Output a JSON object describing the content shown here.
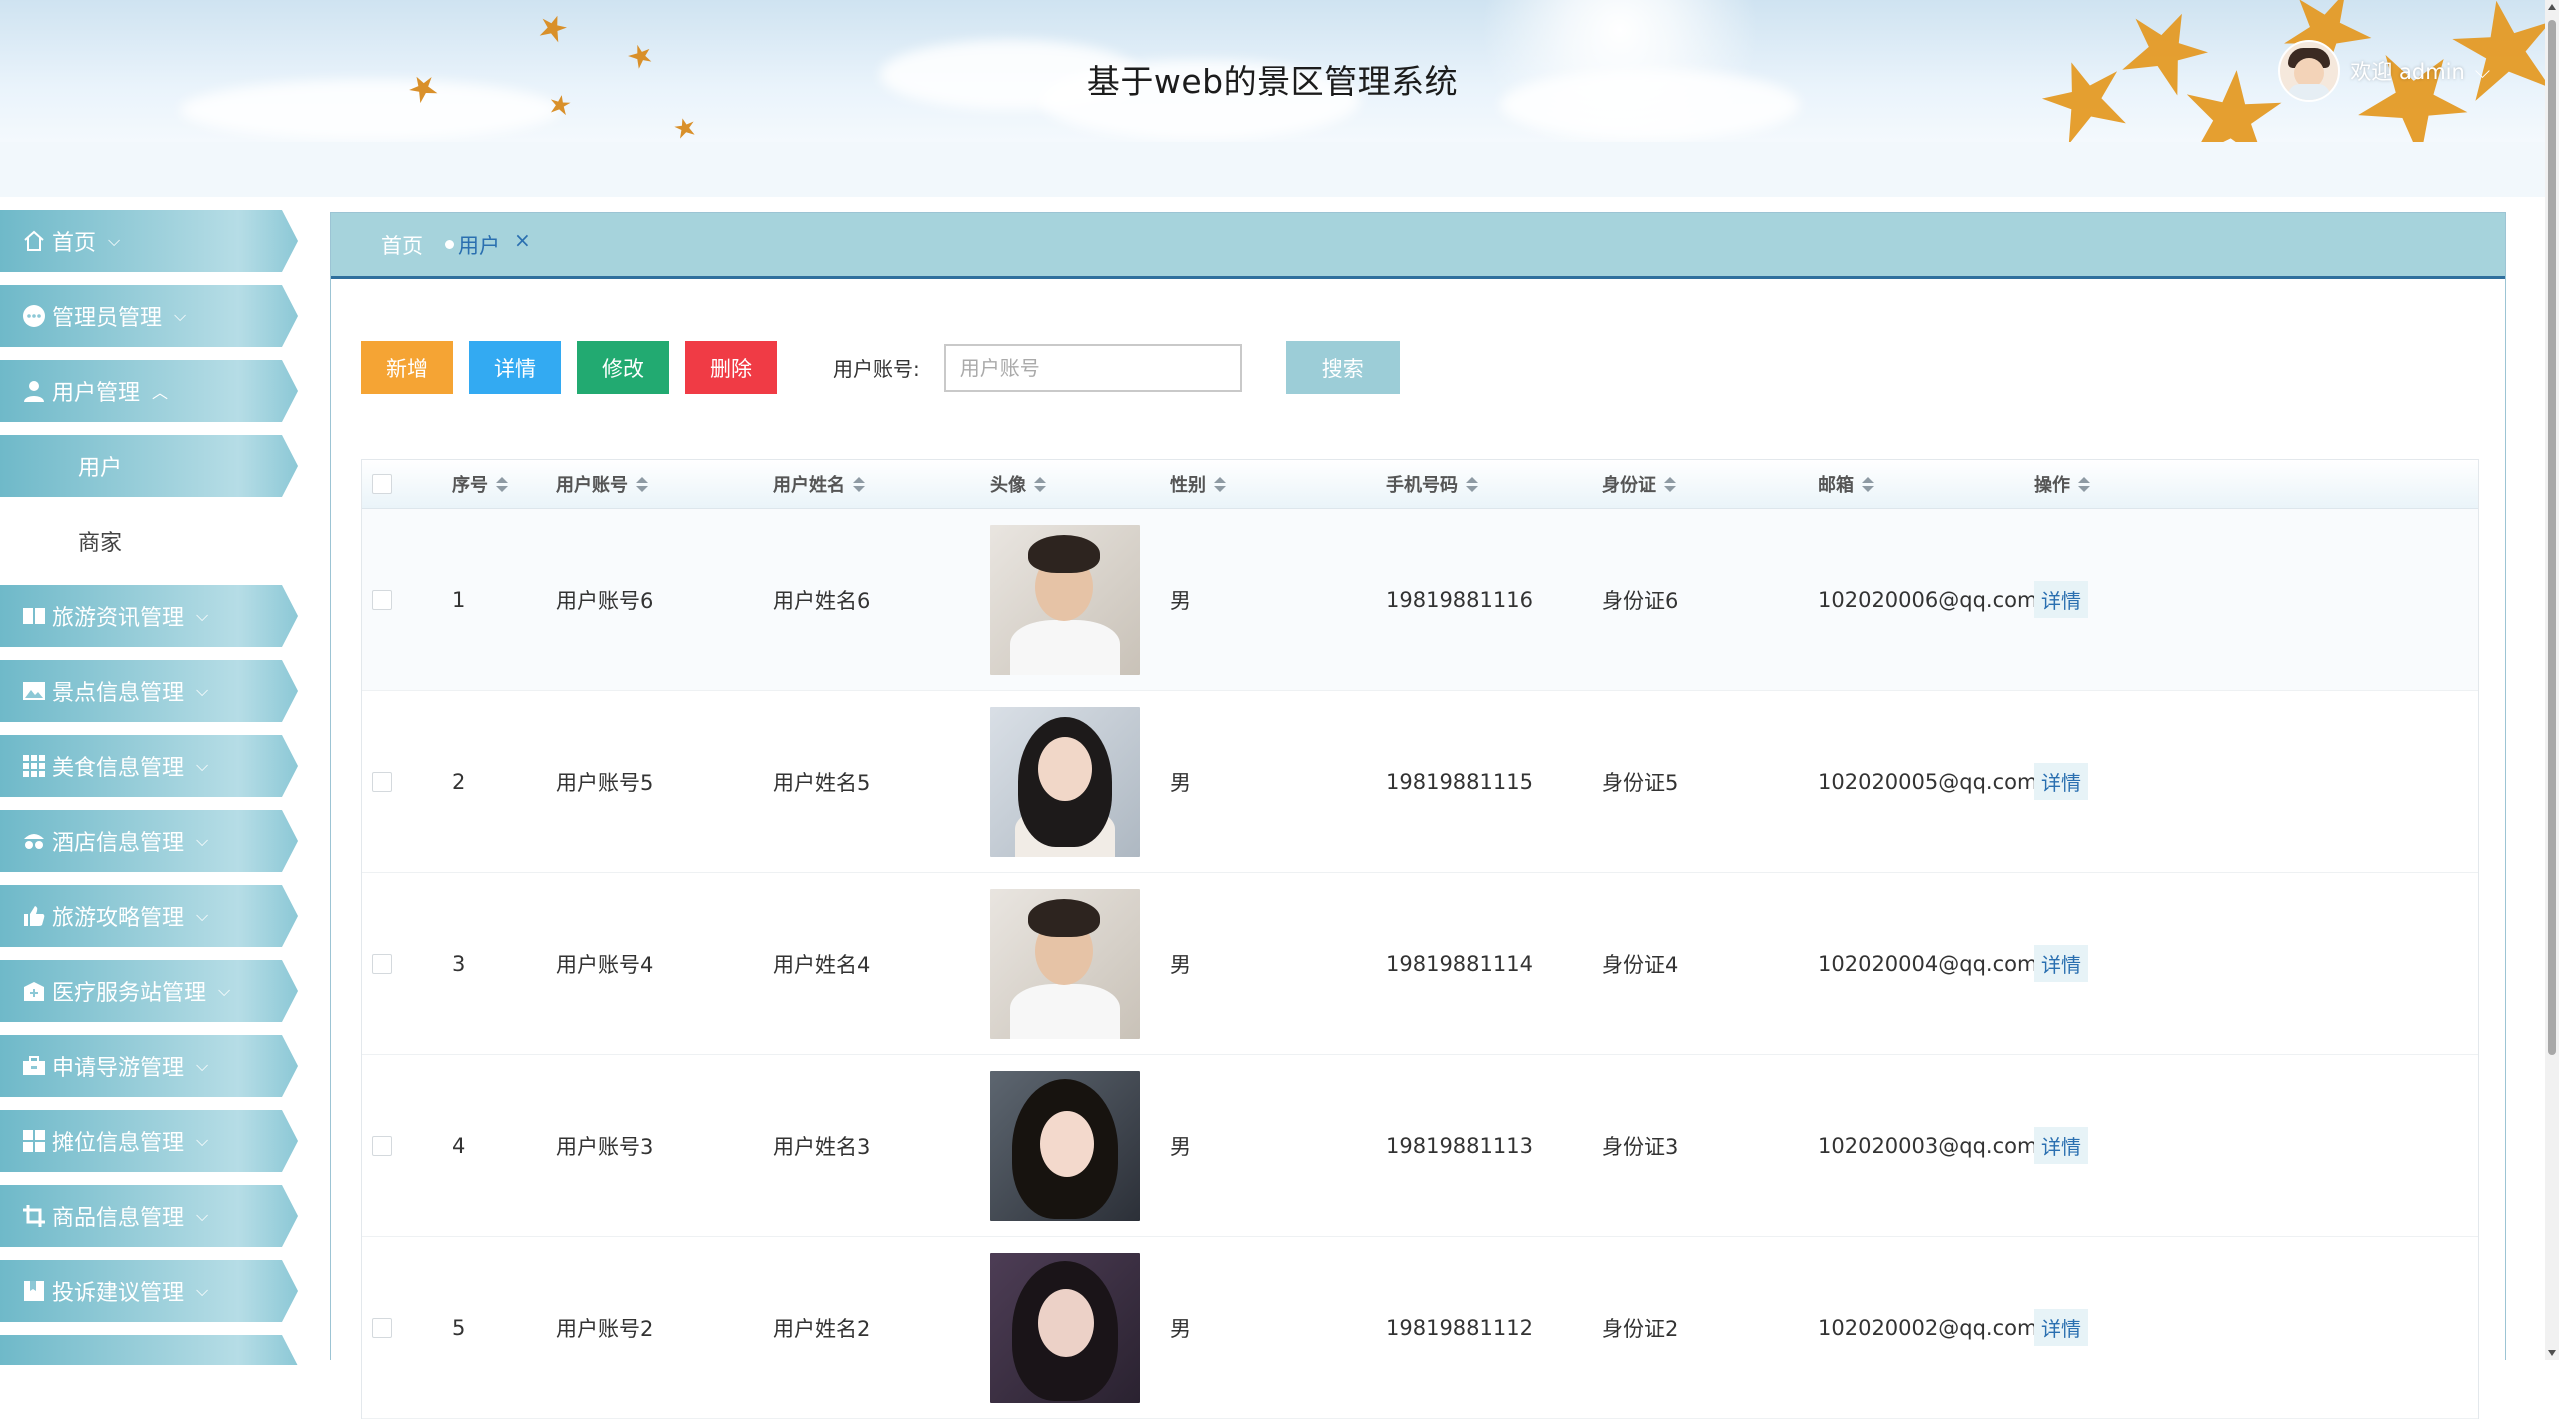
{
  "header": {
    "title": "基于web的景区管理系统",
    "welcome": "欢迎 admin"
  },
  "sidebar": {
    "items": [
      {
        "label": "首页",
        "icon": "home-icon"
      },
      {
        "label": "管理员管理",
        "icon": "more-circle-icon"
      },
      {
        "label": "用户管理",
        "icon": "user-icon",
        "expanded": true,
        "children": [
          {
            "label": "用户",
            "active": true
          },
          {
            "label": "商家",
            "active": false
          }
        ]
      },
      {
        "label": "旅游资讯管理",
        "icon": "book-icon"
      },
      {
        "label": "景点信息管理",
        "icon": "picture-icon"
      },
      {
        "label": "美食信息管理",
        "icon": "grid-icon"
      },
      {
        "label": "酒店信息管理",
        "icon": "hotel-icon"
      },
      {
        "label": "旅游攻略管理",
        "icon": "thumb-icon"
      },
      {
        "label": "医疗服务站管理",
        "icon": "medical-icon"
      },
      {
        "label": "申请导游管理",
        "icon": "briefcase-icon"
      },
      {
        "label": "摊位信息管理",
        "icon": "grid-icon"
      },
      {
        "label": "商品信息管理",
        "icon": "crop-icon"
      },
      {
        "label": "投诉建议管理",
        "icon": "bookmark-icon"
      }
    ]
  },
  "tabs": {
    "home": "首页",
    "active": "用户",
    "close": "×"
  },
  "toolbar": {
    "add": "新增",
    "detail": "详情",
    "edit": "修改",
    "delete": "删除",
    "search_label": "用户账号:",
    "search_placeholder": "用户账号",
    "search_value": "",
    "search_button": "搜索"
  },
  "table": {
    "columns": [
      "序号",
      "用户账号",
      "用户姓名",
      "头像",
      "性别",
      "手机号码",
      "身份证",
      "邮箱",
      "操作"
    ],
    "rows": [
      {
        "no": "1",
        "account": "用户账号6",
        "name": "用户姓名6",
        "sex": "男",
        "phone": "19819881116",
        "id": "身份证6",
        "email": "102020006@qq.com",
        "op": "详情"
      },
      {
        "no": "2",
        "account": "用户账号5",
        "name": "用户姓名5",
        "sex": "男",
        "phone": "19819881115",
        "id": "身份证5",
        "email": "102020005@qq.com",
        "op": "详情"
      },
      {
        "no": "3",
        "account": "用户账号4",
        "name": "用户姓名4",
        "sex": "男",
        "phone": "19819881114",
        "id": "身份证4",
        "email": "102020004@qq.com",
        "op": "详情"
      },
      {
        "no": "4",
        "account": "用户账号3",
        "name": "用户姓名3",
        "sex": "男",
        "phone": "19819881113",
        "id": "身份证3",
        "email": "102020003@qq.com",
        "op": "详情"
      },
      {
        "no": "5",
        "account": "用户账号2",
        "name": "用户姓名2",
        "sex": "男",
        "phone": "19819881112",
        "id": "身份证2",
        "email": "102020002@qq.com",
        "op": "详情"
      }
    ]
  },
  "colors": {
    "accent": "#2f6f9d",
    "sidebar": "#8cc8d6",
    "add": "#f5a434",
    "detail": "#33aaf2",
    "edit": "#22aa71",
    "delete": "#f03b45",
    "search": "#9ccdd7"
  }
}
